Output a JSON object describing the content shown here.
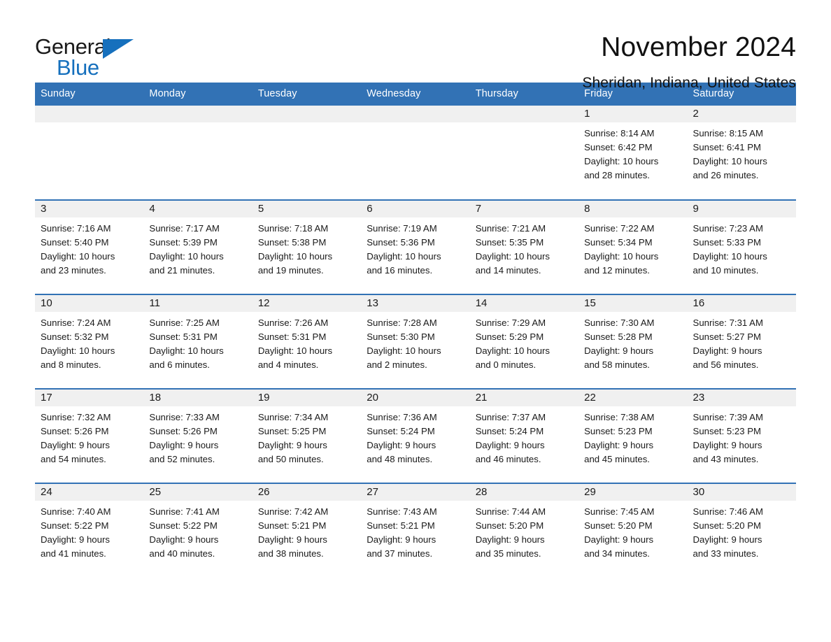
{
  "logo": {
    "word_one": "General",
    "word_two": "Blue",
    "triangle_icon": "blue-triangle-icon",
    "brand_color": "#1670bd"
  },
  "header": {
    "month_title": "November 2024",
    "location": "Sheridan, Indiana, United States"
  },
  "calendar": {
    "header_bg": "#3272b5",
    "daynum_bg": "#f0f0f0",
    "weekday_headers": [
      "Sunday",
      "Monday",
      "Tuesday",
      "Wednesday",
      "Thursday",
      "Friday",
      "Saturday"
    ],
    "weeks": [
      [
        {
          "day": "",
          "lines": []
        },
        {
          "day": "",
          "lines": []
        },
        {
          "day": "",
          "lines": []
        },
        {
          "day": "",
          "lines": []
        },
        {
          "day": "",
          "lines": []
        },
        {
          "day": "1",
          "lines": [
            "Sunrise: 8:14 AM",
            "Sunset: 6:42 PM",
            "Daylight: 10 hours",
            "and 28 minutes."
          ]
        },
        {
          "day": "2",
          "lines": [
            "Sunrise: 8:15 AM",
            "Sunset: 6:41 PM",
            "Daylight: 10 hours",
            "and 26 minutes."
          ]
        }
      ],
      [
        {
          "day": "3",
          "lines": [
            "Sunrise: 7:16 AM",
            "Sunset: 5:40 PM",
            "Daylight: 10 hours",
            "and 23 minutes."
          ]
        },
        {
          "day": "4",
          "lines": [
            "Sunrise: 7:17 AM",
            "Sunset: 5:39 PM",
            "Daylight: 10 hours",
            "and 21 minutes."
          ]
        },
        {
          "day": "5",
          "lines": [
            "Sunrise: 7:18 AM",
            "Sunset: 5:38 PM",
            "Daylight: 10 hours",
            "and 19 minutes."
          ]
        },
        {
          "day": "6",
          "lines": [
            "Sunrise: 7:19 AM",
            "Sunset: 5:36 PM",
            "Daylight: 10 hours",
            "and 16 minutes."
          ]
        },
        {
          "day": "7",
          "lines": [
            "Sunrise: 7:21 AM",
            "Sunset: 5:35 PM",
            "Daylight: 10 hours",
            "and 14 minutes."
          ]
        },
        {
          "day": "8",
          "lines": [
            "Sunrise: 7:22 AM",
            "Sunset: 5:34 PM",
            "Daylight: 10 hours",
            "and 12 minutes."
          ]
        },
        {
          "day": "9",
          "lines": [
            "Sunrise: 7:23 AM",
            "Sunset: 5:33 PM",
            "Daylight: 10 hours",
            "and 10 minutes."
          ]
        }
      ],
      [
        {
          "day": "10",
          "lines": [
            "Sunrise: 7:24 AM",
            "Sunset: 5:32 PM",
            "Daylight: 10 hours",
            "and 8 minutes."
          ]
        },
        {
          "day": "11",
          "lines": [
            "Sunrise: 7:25 AM",
            "Sunset: 5:31 PM",
            "Daylight: 10 hours",
            "and 6 minutes."
          ]
        },
        {
          "day": "12",
          "lines": [
            "Sunrise: 7:26 AM",
            "Sunset: 5:31 PM",
            "Daylight: 10 hours",
            "and 4 minutes."
          ]
        },
        {
          "day": "13",
          "lines": [
            "Sunrise: 7:28 AM",
            "Sunset: 5:30 PM",
            "Daylight: 10 hours",
            "and 2 minutes."
          ]
        },
        {
          "day": "14",
          "lines": [
            "Sunrise: 7:29 AM",
            "Sunset: 5:29 PM",
            "Daylight: 10 hours",
            "and 0 minutes."
          ]
        },
        {
          "day": "15",
          "lines": [
            "Sunrise: 7:30 AM",
            "Sunset: 5:28 PM",
            "Daylight: 9 hours",
            "and 58 minutes."
          ]
        },
        {
          "day": "16",
          "lines": [
            "Sunrise: 7:31 AM",
            "Sunset: 5:27 PM",
            "Daylight: 9 hours",
            "and 56 minutes."
          ]
        }
      ],
      [
        {
          "day": "17",
          "lines": [
            "Sunrise: 7:32 AM",
            "Sunset: 5:26 PM",
            "Daylight: 9 hours",
            "and 54 minutes."
          ]
        },
        {
          "day": "18",
          "lines": [
            "Sunrise: 7:33 AM",
            "Sunset: 5:26 PM",
            "Daylight: 9 hours",
            "and 52 minutes."
          ]
        },
        {
          "day": "19",
          "lines": [
            "Sunrise: 7:34 AM",
            "Sunset: 5:25 PM",
            "Daylight: 9 hours",
            "and 50 minutes."
          ]
        },
        {
          "day": "20",
          "lines": [
            "Sunrise: 7:36 AM",
            "Sunset: 5:24 PM",
            "Daylight: 9 hours",
            "and 48 minutes."
          ]
        },
        {
          "day": "21",
          "lines": [
            "Sunrise: 7:37 AM",
            "Sunset: 5:24 PM",
            "Daylight: 9 hours",
            "and 46 minutes."
          ]
        },
        {
          "day": "22",
          "lines": [
            "Sunrise: 7:38 AM",
            "Sunset: 5:23 PM",
            "Daylight: 9 hours",
            "and 45 minutes."
          ]
        },
        {
          "day": "23",
          "lines": [
            "Sunrise: 7:39 AM",
            "Sunset: 5:23 PM",
            "Daylight: 9 hours",
            "and 43 minutes."
          ]
        }
      ],
      [
        {
          "day": "24",
          "lines": [
            "Sunrise: 7:40 AM",
            "Sunset: 5:22 PM",
            "Daylight: 9 hours",
            "and 41 minutes."
          ]
        },
        {
          "day": "25",
          "lines": [
            "Sunrise: 7:41 AM",
            "Sunset: 5:22 PM",
            "Daylight: 9 hours",
            "and 40 minutes."
          ]
        },
        {
          "day": "26",
          "lines": [
            "Sunrise: 7:42 AM",
            "Sunset: 5:21 PM",
            "Daylight: 9 hours",
            "and 38 minutes."
          ]
        },
        {
          "day": "27",
          "lines": [
            "Sunrise: 7:43 AM",
            "Sunset: 5:21 PM",
            "Daylight: 9 hours",
            "and 37 minutes."
          ]
        },
        {
          "day": "28",
          "lines": [
            "Sunrise: 7:44 AM",
            "Sunset: 5:20 PM",
            "Daylight: 9 hours",
            "and 35 minutes."
          ]
        },
        {
          "day": "29",
          "lines": [
            "Sunrise: 7:45 AM",
            "Sunset: 5:20 PM",
            "Daylight: 9 hours",
            "and 34 minutes."
          ]
        },
        {
          "day": "30",
          "lines": [
            "Sunrise: 7:46 AM",
            "Sunset: 5:20 PM",
            "Daylight: 9 hours",
            "and 33 minutes."
          ]
        }
      ]
    ]
  }
}
